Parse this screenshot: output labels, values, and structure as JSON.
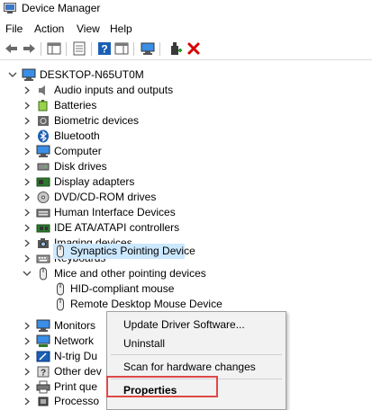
{
  "window": {
    "title": "Device Manager"
  },
  "menu": [
    "File",
    "Action",
    "View",
    "Help"
  ],
  "toolbar": {
    "buttons": [
      "back-arrow-icon",
      "forward-arrow-icon",
      "console-tree-icon",
      "properties-sheet-icon",
      "help-icon",
      "action-pane-icon",
      "monitor-scan-icon",
      "add-driver-icon",
      "delete-x-icon"
    ],
    "delete_color": "#d40000"
  },
  "tree": {
    "root": "DESKTOP-N65UT0M",
    "categories": [
      "Audio inputs and outputs",
      "Batteries",
      "Biometric devices",
      "Bluetooth",
      "Computer",
      "Disk drives",
      "Display adapters",
      "DVD/CD-ROM drives",
      "Human Interface Devices",
      "IDE ATA/ATAPI controllers",
      "Imaging devices",
      "Keyboards",
      "Mice and other pointing devices"
    ],
    "mice_children": [
      "HID-compliant mouse",
      "Remote Desktop Mouse Device",
      "Synaptics Pointing Device"
    ],
    "after": [
      "Monitors",
      "Network",
      "N-trig Du",
      "Other dev",
      "Print que",
      "Processo"
    ]
  },
  "context_menu": {
    "items": [
      "Update Driver Software...",
      "Uninstall",
      "Scan for hardware changes",
      "Properties"
    ],
    "highlight_color": "#e04848"
  },
  "colors": {
    "selection": "#cce8ff"
  }
}
